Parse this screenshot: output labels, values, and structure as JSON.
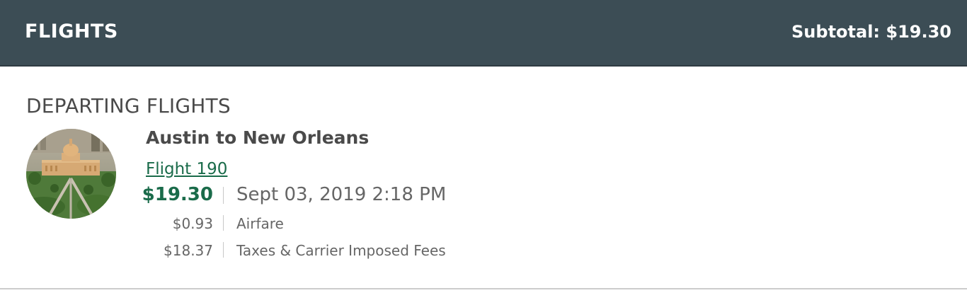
{
  "header": {
    "title": "FLIGHTS",
    "subtotal": "Subtotal: $19.30",
    "background_color": "#3c4d55"
  },
  "section": {
    "title": "DEPARTING FLIGHTS"
  },
  "flight": {
    "image_icon": "capitol-building-photo",
    "route": "Austin to New Orleans",
    "flight_link": "Flight 190",
    "total_price": "$19.30",
    "departure": "Sept 03, 2019 2:18 PM",
    "breakdown": [
      {
        "amount": "$0.93",
        "label": "Airfare"
      },
      {
        "amount": "$18.37",
        "label": "Taxes & Carrier Imposed Fees"
      }
    ],
    "accent_color": "#1a6b4a"
  }
}
